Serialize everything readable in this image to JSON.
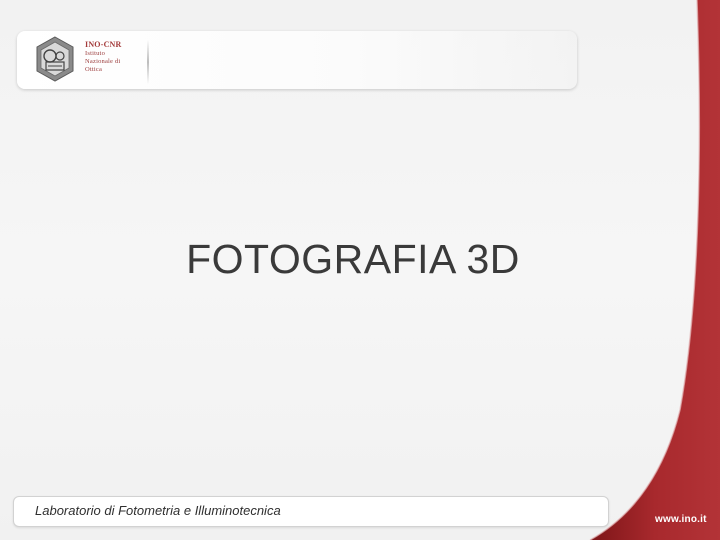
{
  "header": {
    "logo": {
      "org": "INO-CNR",
      "lines": [
        "Istituto",
        "Nazionale di",
        "Ottica"
      ]
    }
  },
  "slide": {
    "title": "FOTOGRAFIA 3D"
  },
  "footer": {
    "label": "Laboratorio di Fotometria e Illuminotecnica",
    "website": "www.ino.it"
  },
  "colors": {
    "accent_red": "#a8292d",
    "background": "#f3f3f3",
    "title_text": "#3a3a3a"
  }
}
